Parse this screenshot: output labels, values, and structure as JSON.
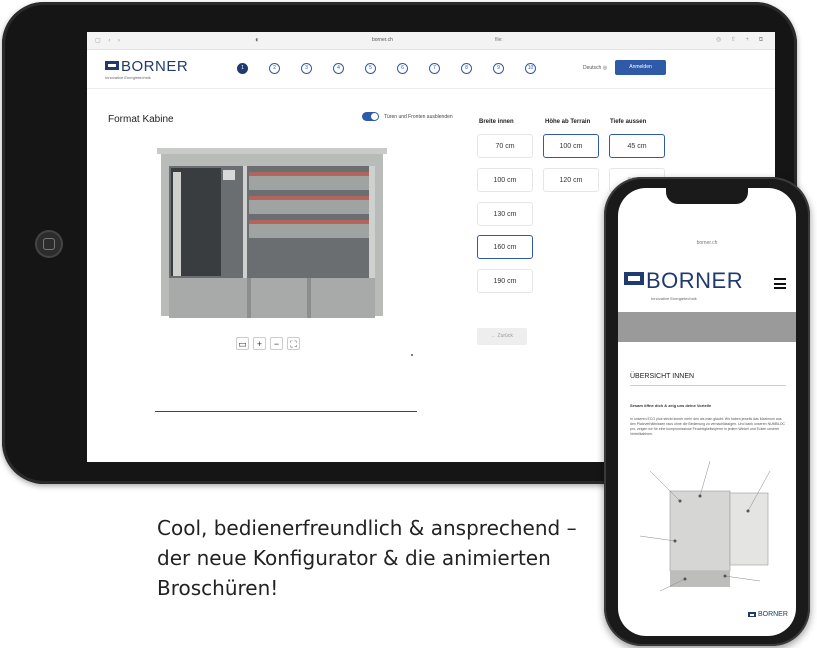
{
  "browser": {
    "url": "borner.ch",
    "tab": "file:"
  },
  "app": {
    "logo": "BORNER",
    "logo_sub": "Innovative Energietechnik",
    "steps": [
      "1",
      "2",
      "3",
      "4",
      "5",
      "6",
      "7",
      "8",
      "9",
      "10"
    ],
    "lang": "Deutsch",
    "login_label": "Anmelden"
  },
  "main": {
    "section_title": "Format Kabine",
    "toggle_label": "Türen und Fronten ausblenden",
    "columns": [
      {
        "label": "Breite innen"
      },
      {
        "label": "Höhe ab Terrain"
      },
      {
        "label": "Tiefe aussen"
      }
    ],
    "breite": [
      "70 cm",
      "100 cm",
      "130 cm",
      "160 cm",
      "190 cm"
    ],
    "hoehe": [
      "100 cm",
      "120 cm"
    ],
    "tiefe": [
      "45 cm",
      "62 cm"
    ],
    "back_label": "← Zurück",
    "zoom_icons": [
      "▭",
      "+",
      "−",
      "⛶"
    ]
  },
  "phone": {
    "url": "borner.ch",
    "logo": "BORNER",
    "logo_sub": "Innovative Energietechnik",
    "section_title": "ÜBERSICHT INNEN",
    "subtitle": "Sesam öffne dich & zeig uns deine Vorteile",
    "body": "In unseren ECO plus steckt immer mehr drin als man glaubt: Wir haben jeweils das Maximum aus den Platzverhältnissen raus ohne die Bedienung zu vernachlässigen. Und dank unseren NUMBLOC pro, zeigen wir für eine kompromisslose Feuchtigkeitssperre in jedem Winkel und Ecken unserer Verteilkabinen.",
    "footer_logo": "BORNER"
  },
  "caption": {
    "line1": "Cool, bedienerfreundlich & ansprechend –",
    "line2": "der neue Konfigurator & die animierten",
    "line3": "Broschüren!"
  },
  "colors": {
    "brand": "#1f3a6e",
    "accent": "#2f5aa8"
  }
}
